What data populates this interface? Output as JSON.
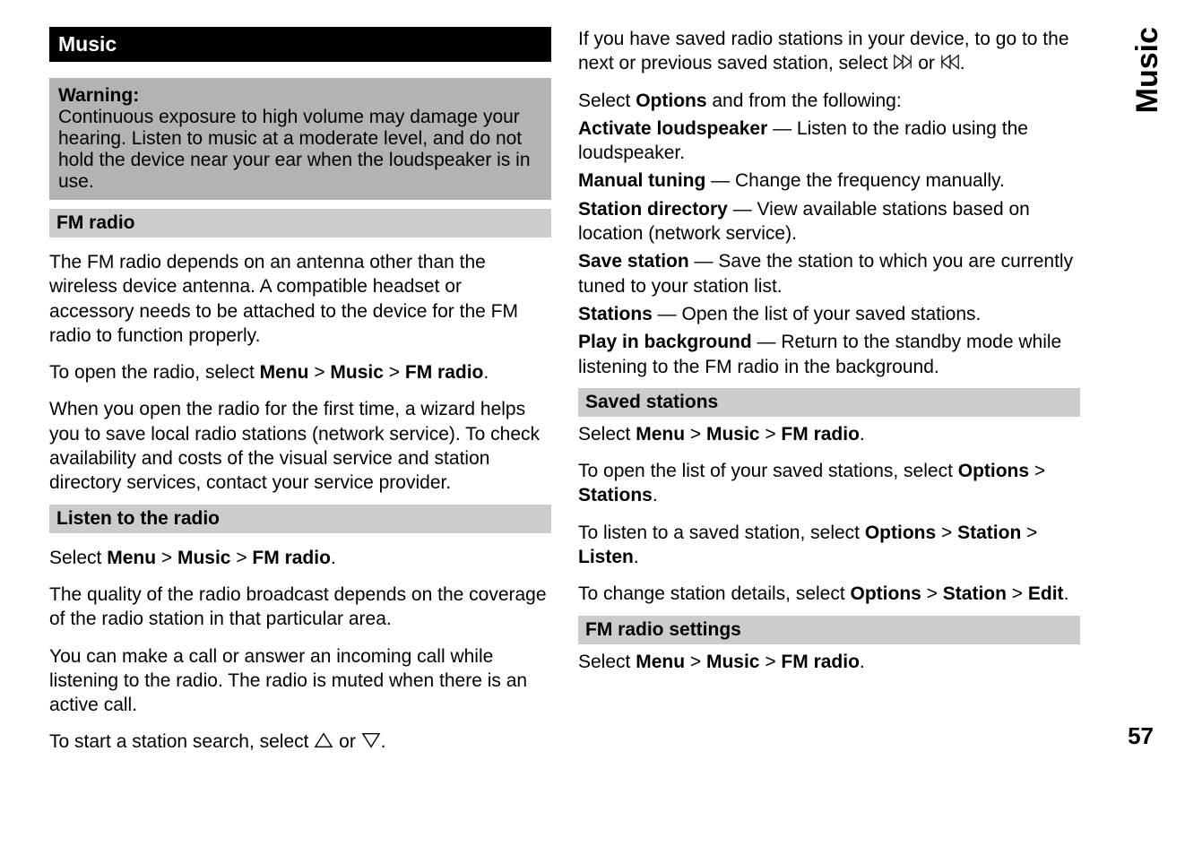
{
  "page": {
    "side_label": "Music",
    "number": "57"
  },
  "left": {
    "header": "Music",
    "warning": {
      "title": "Warning:",
      "body": "Continuous exposure to high volume may damage your hearing. Listen to music at a moderate level, and do not hold the device near your ear when the loudspeaker is in use."
    },
    "fm_radio": {
      "head": "FM radio",
      "p1": "The FM radio depends on an antenna other than the wireless device antenna. A compatible headset or accessory needs to be attached to the device for the FM radio to function properly.",
      "p2_pre": "To open the radio, select ",
      "menu": "Menu",
      "gt1": " > ",
      "music": "Music",
      "gt2": " > ",
      "fm": "FM radio",
      "p2_post": ".",
      "p3": "When you open the radio for the first time, a wizard helps you to save local radio stations (network service). To check availability and costs of the visual service and station directory services, contact your service provider."
    },
    "listen": {
      "head": "Listen to the radio",
      "sel_pre": "Select ",
      "menu": "Menu",
      "gt1": " > ",
      "music": "Music",
      "gt2": " > ",
      "fm": "FM radio",
      "sel_post": ".",
      "p1": "The quality of the radio broadcast depends on the coverage of the radio station in that particular area.",
      "p2": "You can make a call or answer an incoming call while listening to the radio. The radio is muted when there is an active call.",
      "p3_pre": "To start a station search, select ",
      "p3_mid": " or ",
      "p3_post": "."
    }
  },
  "right": {
    "saved_pre": "If you have saved radio stations in your device, to go to the next or previous saved station, select ",
    "saved_mid": " or ",
    "saved_post": ".",
    "options_line_pre": "Select ",
    "options_word": "Options",
    "options_line_post": " and from the following:",
    "opts": {
      "activate": {
        "label": "Activate loudspeaker",
        "desc": "  — Listen to the radio using the loudspeaker."
      },
      "manual": {
        "label": "Manual tuning",
        "desc": "  — Change the frequency manually."
      },
      "dir": {
        "label": "Station directory",
        "desc": "  — View available stations based on location (network service)."
      },
      "save": {
        "label": "Save station",
        "desc": "  — Save the station to which you are currently tuned to your station list."
      },
      "stations": {
        "label": "Stations",
        "desc": "  — Open the list of your saved stations."
      },
      "play": {
        "label": "Play in background",
        "desc": "  — Return to the standby mode while listening to the FM radio in the background."
      }
    },
    "saved": {
      "head": "Saved stations",
      "sel_pre": "Select ",
      "menu": "Menu",
      "gt1": " > ",
      "music": "Music",
      "gt2": " > ",
      "fm": "FM radio",
      "sel_post": ".",
      "p1_pre": "To open the list of your saved stations, select ",
      "options": "Options",
      "gt": " > ",
      "stations": "Stations",
      "p1_post": ".",
      "p2_pre": "To listen to a saved station, select ",
      "p2_options": "Options",
      "p2_gt1": " > ",
      "p2_station": "Station",
      "p2_gt2": " > ",
      "p2_listen": "Listen",
      "p2_post": ".",
      "p3_pre": "To change station details, select ",
      "p3_options": "Options",
      "p3_gt1": " > ",
      "p3_station": "Station",
      "p3_gt2": " > ",
      "p3_edit": "Edit",
      "p3_post": "."
    },
    "settings": {
      "head": "FM radio settings",
      "sel_pre": "Select ",
      "menu": "Menu",
      "gt1": " > ",
      "music": "Music",
      "gt2": " > ",
      "fm": "FM radio",
      "sel_post": "."
    }
  }
}
